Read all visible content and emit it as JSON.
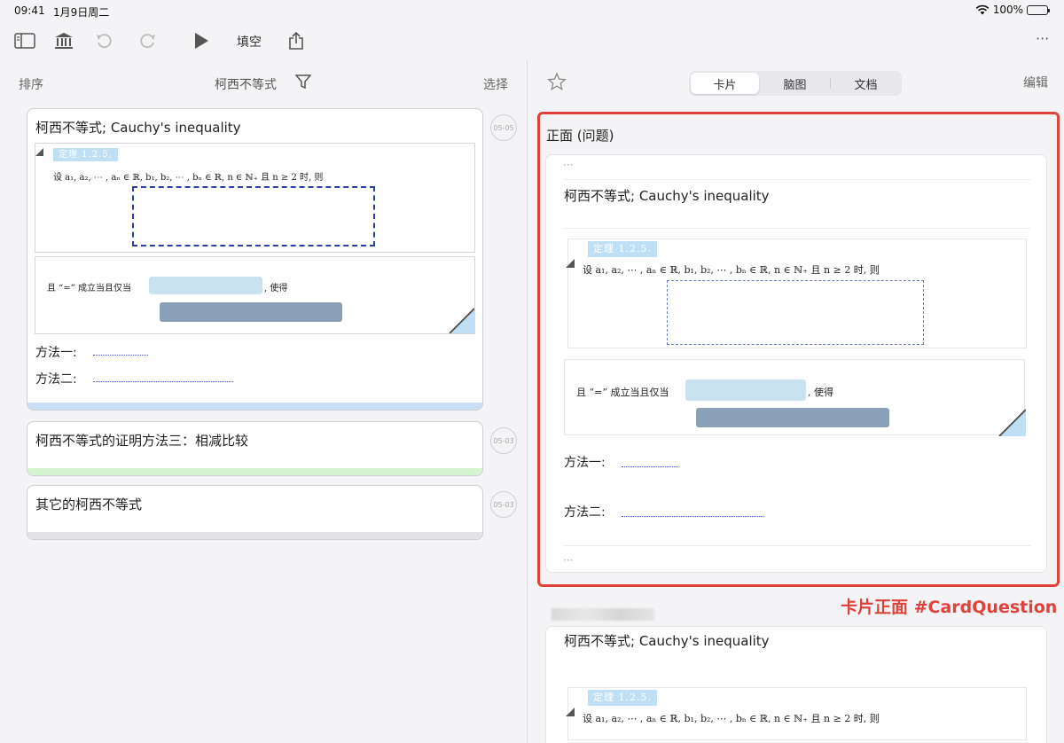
{
  "status": {
    "time": "09:41",
    "date": "1月9日周二",
    "battery": "100%"
  },
  "toolbar": {
    "fill_label": "填空",
    "more": "···"
  },
  "left": {
    "sort": "排序",
    "title": "柯西不等式",
    "select": "选择",
    "cards": [
      {
        "title": "柯西不等式; Cauchy's inequality",
        "date": "05-05",
        "bar_color": "#c8dff6"
      },
      {
        "title": "柯西不等式的证明方法三：相减比较",
        "date": "05-03",
        "bar_color": "#d4f5cf"
      },
      {
        "title": "其它的柯西不等式",
        "date": "05-03",
        "bar_color": "#e3e3e5"
      }
    ]
  },
  "theorem": {
    "tag": "定理 1.2.5.",
    "line1": "设 a₁, a₂, ⋯ , aₙ ∈ ℝ, b₁, b₂, ⋯ , bₙ ∈ ℝ, n ∈ ℕ₊ 且 n ≥ 2 时, 则",
    "line2_prefix": "且 “=” 成立当且仅当",
    "line2_suffix": ", 使得",
    "method1": "方法一:",
    "method2": "方法二:"
  },
  "right": {
    "tabs": [
      "卡片",
      "脑图",
      "文档"
    ],
    "edit": "编辑",
    "face_label": "正面 (问题)",
    "ellipsis": "···",
    "card_title": "柯西不等式; Cauchy's inequality",
    "method1": "方法一:",
    "method2": "方法二:",
    "annotation": "卡片正面 #CardQuestion",
    "frame_color": "#e0413a"
  }
}
